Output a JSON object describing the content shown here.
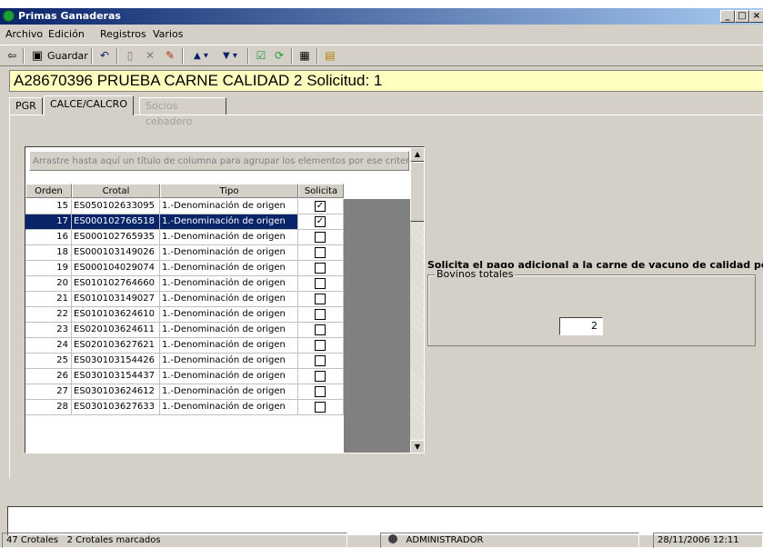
{
  "window": {
    "title": "Primas Ganaderas",
    "controls": [
      "_",
      "□",
      "×"
    ]
  },
  "menu": [
    {
      "label": "Archivo",
      "mnemonic": "A"
    },
    {
      "label": "Edición",
      "mnemonic": "E"
    },
    {
      "label": "Registros",
      "mnemonic": "R"
    },
    {
      "label": "Varios",
      "mnemonic": "V"
    }
  ],
  "toolbar": {
    "save_label": "Guardar",
    "icons": [
      "back-arrow-icon",
      "save-icon",
      "undo-icon",
      "new-document-icon",
      "delete-icon",
      "edit-icon",
      "move-up-icon",
      "move-down-icon",
      "check-icon",
      "refresh-icon",
      "calculator-icon",
      "notes-icon"
    ]
  },
  "record": {
    "header": "A28670396  PRUEBA CARNE CALIDAD 2  Solicitud: 1"
  },
  "tabs": [
    {
      "label": "PGR",
      "active": false,
      "enabled": true
    },
    {
      "label": "CALCE/CALCRO",
      "active": true,
      "enabled": true
    },
    {
      "label": "Socios cebadero",
      "active": false,
      "enabled": false
    }
  ],
  "grid": {
    "group_hint": "Arrastre hasta aquí un título de columna para agrupar los elementos por ese criterio",
    "columns": [
      "Orden",
      "Crotal",
      "Tipo",
      "Solicita"
    ],
    "rows": [
      {
        "orden": "15",
        "crotal": "ES050102633095",
        "tipo": "1.-Denominación de origen",
        "solicita": true,
        "selected": false
      },
      {
        "orden": "17",
        "crotal": "ES000102766518",
        "tipo": "1.-Denominación de origen",
        "solicita": true,
        "selected": true
      },
      {
        "orden": "16",
        "crotal": "ES000102765935",
        "tipo": "1.-Denominación de origen",
        "solicita": false,
        "selected": false
      },
      {
        "orden": "18",
        "crotal": "ES000103149026",
        "tipo": "1.-Denominación de origen",
        "solicita": false,
        "selected": false
      },
      {
        "orden": "19",
        "crotal": "ES000104029074",
        "tipo": "1.-Denominación de origen",
        "solicita": false,
        "selected": false
      },
      {
        "orden": "20",
        "crotal": "ES010102764660",
        "tipo": "1.-Denominación de origen",
        "solicita": false,
        "selected": false
      },
      {
        "orden": "21",
        "crotal": "ES010103149027",
        "tipo": "1.-Denominación de origen",
        "solicita": false,
        "selected": false
      },
      {
        "orden": "22",
        "crotal": "ES010103624610",
        "tipo": "1.-Denominación de origen",
        "solicita": false,
        "selected": false
      },
      {
        "orden": "23",
        "crotal": "ES020103624611",
        "tipo": "1.-Denominación de origen",
        "solicita": false,
        "selected": false
      },
      {
        "orden": "24",
        "crotal": "ES020103627621",
        "tipo": "1.-Denominación de origen",
        "solicita": false,
        "selected": false
      },
      {
        "orden": "25",
        "crotal": "ES030103154426",
        "tipo": "1.-Denominación de origen",
        "solicita": false,
        "selected": false
      },
      {
        "orden": "26",
        "crotal": "ES030103154437",
        "tipo": "1.-Denominación de origen",
        "solicita": false,
        "selected": false
      },
      {
        "orden": "27",
        "crotal": "ES030103624612",
        "tipo": "1.-Denominación de origen",
        "solicita": false,
        "selected": false
      },
      {
        "orden": "28",
        "crotal": "ES030103627633",
        "tipo": "1.-Denominación de origen",
        "solicita": false,
        "selected": false
      }
    ]
  },
  "right_panel": {
    "prompt": "Solicita el pago adicional a la carne de vacuno de calidad por:",
    "groupbox_title": "Bovinos totales",
    "bovinos_totales": "2"
  },
  "status": {
    "crotales": "47 Crotales",
    "marcados": "2 Crotales marcados",
    "user": "ADMINISTRADOR",
    "datetime": "28/11/2006  12:11"
  }
}
